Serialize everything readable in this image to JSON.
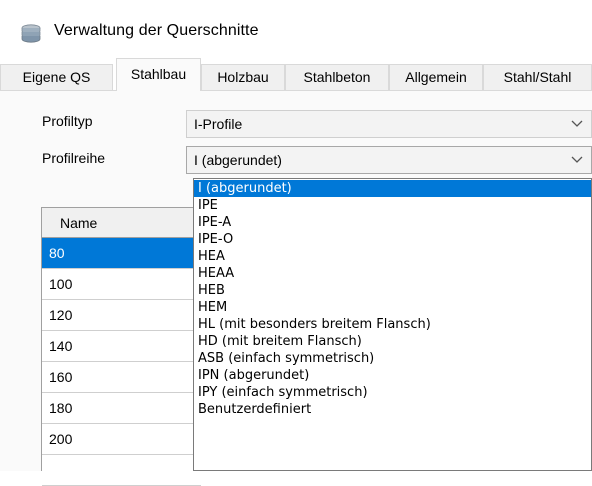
{
  "window": {
    "title": "Verwaltung der Querschnitte",
    "icon": "stack-icon"
  },
  "tabs": [
    {
      "label": "Eigene QS",
      "active": false
    },
    {
      "label": "Stahlbau",
      "active": true
    },
    {
      "label": "Holzbau",
      "active": false
    },
    {
      "label": "Stahlbeton",
      "active": false
    },
    {
      "label": "Allgemein",
      "active": false
    },
    {
      "label": "Stahl/Stahl",
      "active": false
    }
  ],
  "form": {
    "profiltyp": {
      "label": "Profiltyp",
      "value": "I-Profile"
    },
    "profilreihe": {
      "label": "Profilreihe",
      "value": "I (abgerundet)"
    }
  },
  "table": {
    "header": "Name",
    "rows": [
      "80",
      "100",
      "120",
      "140",
      "160",
      "180",
      "200"
    ],
    "selected_index": 0
  },
  "dropdown": {
    "selected_index": 0,
    "options": [
      "I (abgerundet)",
      "IPE",
      "IPE-A",
      "IPE-O",
      "HEA",
      "HEAA",
      "HEB",
      "HEM",
      "HL (mit besonders breitem Flansch)",
      "HD (mit breitem Flansch)",
      "ASB (einfach symmetrisch)",
      "IPN (abgerundet)",
      "IPY (einfach symmetrisch)",
      "Benutzerdefiniert"
    ]
  },
  "colors": {
    "selection": "#0078d7",
    "panel": "#fafafa",
    "tab_inactive": "#f0f0f0"
  }
}
